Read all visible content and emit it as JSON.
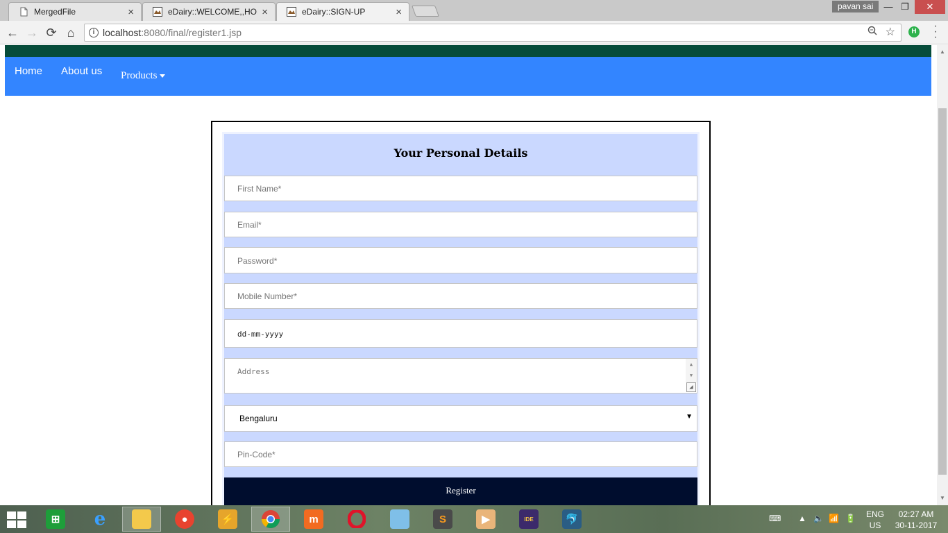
{
  "browser": {
    "tabs": [
      {
        "title": "MergedFile",
        "close": "×",
        "active": false
      },
      {
        "title": "eDairy::WELCOME,,HOM",
        "close": "×",
        "active": false
      },
      {
        "title": "eDairy::SIGN-UP",
        "close": "×",
        "active": true
      }
    ],
    "profile_name": "pavan sai",
    "window_controls": {
      "minimize": "—",
      "restore": "❐",
      "close": "✕"
    },
    "nav": {
      "back": "←",
      "forward": "→",
      "reload": "⟳",
      "home": "⌂"
    },
    "url_host": "localhost",
    "url_rest": ":8080/final/register1.jsp",
    "ext_label": "H"
  },
  "page": {
    "nav": {
      "home": "Home",
      "about": "About us",
      "products": "Products"
    },
    "form": {
      "title": "Your Personal Details",
      "first_name_placeholder": "First Name*",
      "email_placeholder": "Email*",
      "password_placeholder": "Password*",
      "mobile_placeholder": "Mobile Number*",
      "dob_value": "dd-mm-yyyy",
      "address_placeholder": "Address",
      "city_selected": "Bengaluru",
      "pincode_placeholder": "Pin-Code*",
      "register_label": "Register"
    }
  },
  "taskbar": {
    "language": [
      "ENG",
      "US"
    ],
    "time": "02:27 AM",
    "date": "30-11-2017",
    "icons": [
      "windows-start",
      "store",
      "internet-explorer",
      "file-explorer",
      "screen-recorder",
      "winamp",
      "chrome",
      "mi-pc-suite",
      "opera",
      "photos",
      "sublime-text",
      "video-player",
      "java-ee-ide",
      "mysql-workbench"
    ]
  },
  "colors": {
    "navbar": "#3385ff",
    "green_strip": "#064c3a",
    "form_bg": "#cad8ff",
    "register_bg": "#000d2e"
  }
}
